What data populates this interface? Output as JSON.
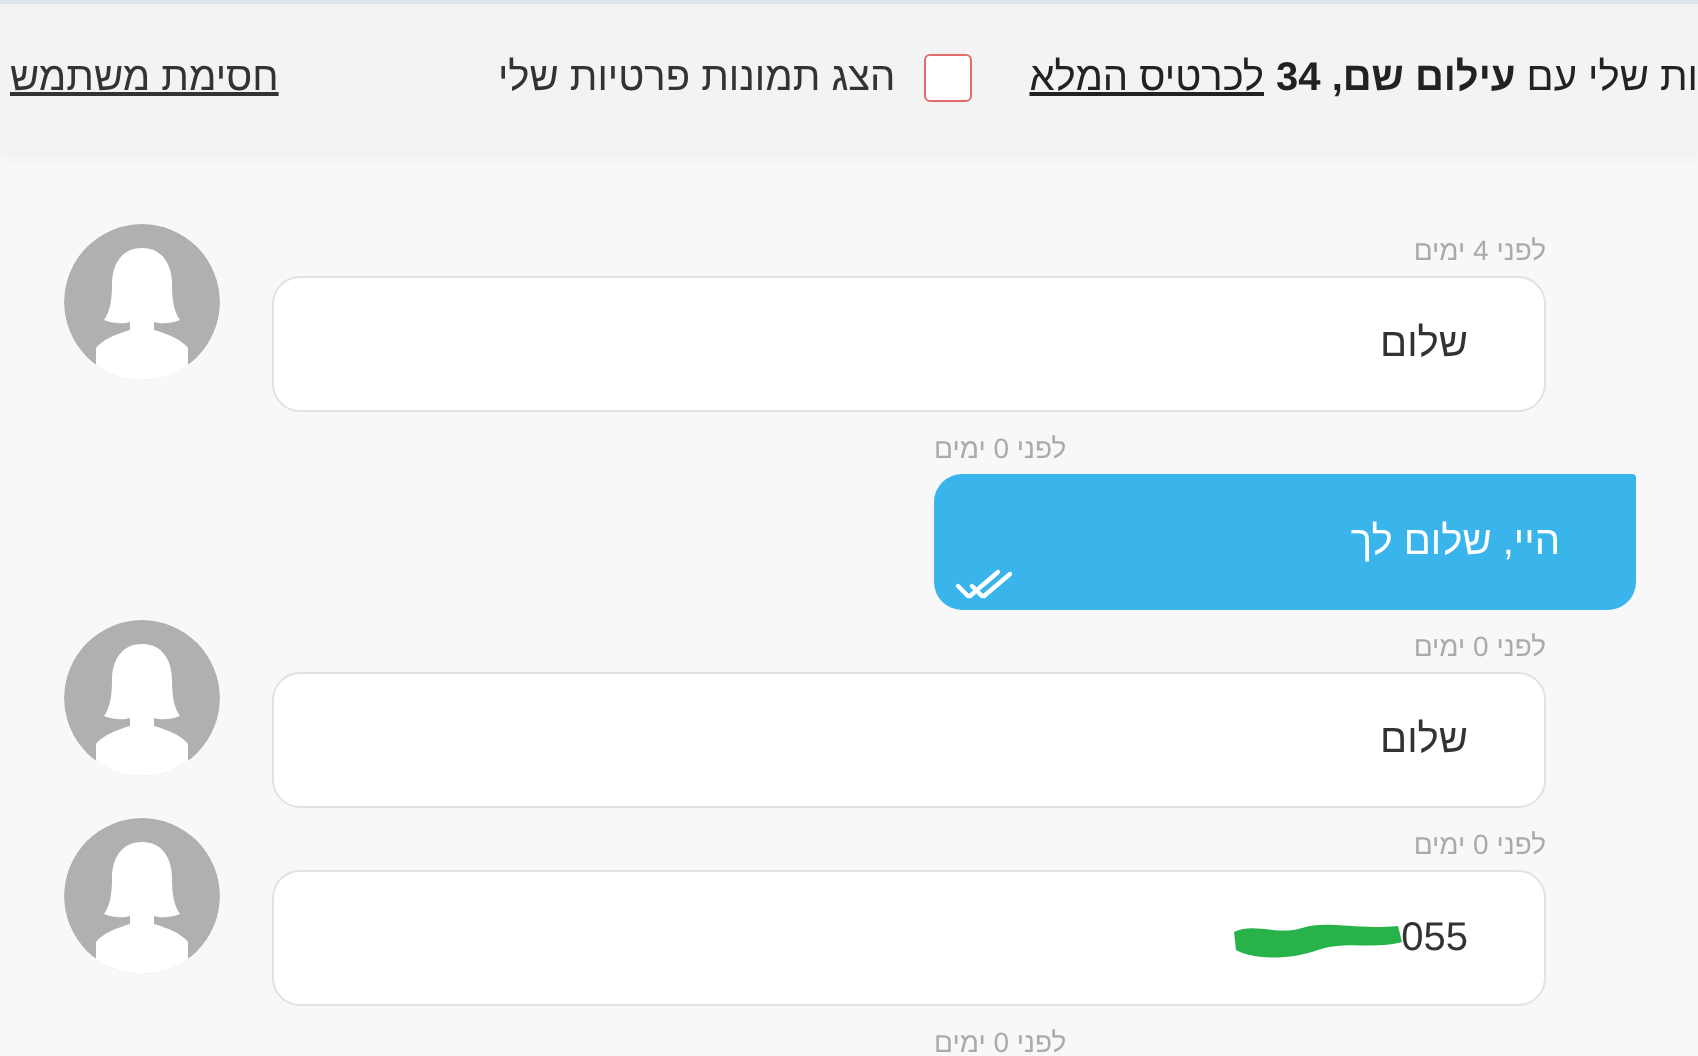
{
  "top_bar": {
    "heading": "ות שלי עם **עילום שם, 34**",
    "profile_link": "לכרטיס המלא",
    "private_photos": {
      "label": "הצג תמונות פרטיות שלי",
      "checked": false
    },
    "block_link": "חסימת משתמש"
  },
  "messages": [
    {
      "kind": "incoming",
      "time": "לפני 4 ימים",
      "text": "שלום",
      "redacted": false
    },
    {
      "kind": "outgoing",
      "time": "לפני 0 ימים",
      "text": "היי, שלום לך",
      "read": true,
      "redacted": false
    },
    {
      "kind": "incoming",
      "time": "לפני 0 ימים",
      "text": "שלום",
      "redacted": false
    },
    {
      "kind": "incoming",
      "time": "לפני 0 ימים",
      "text": "055",
      "redacted": true
    },
    {
      "kind": "outgoing",
      "time": "לפני 0 ימים"
    }
  ]
}
